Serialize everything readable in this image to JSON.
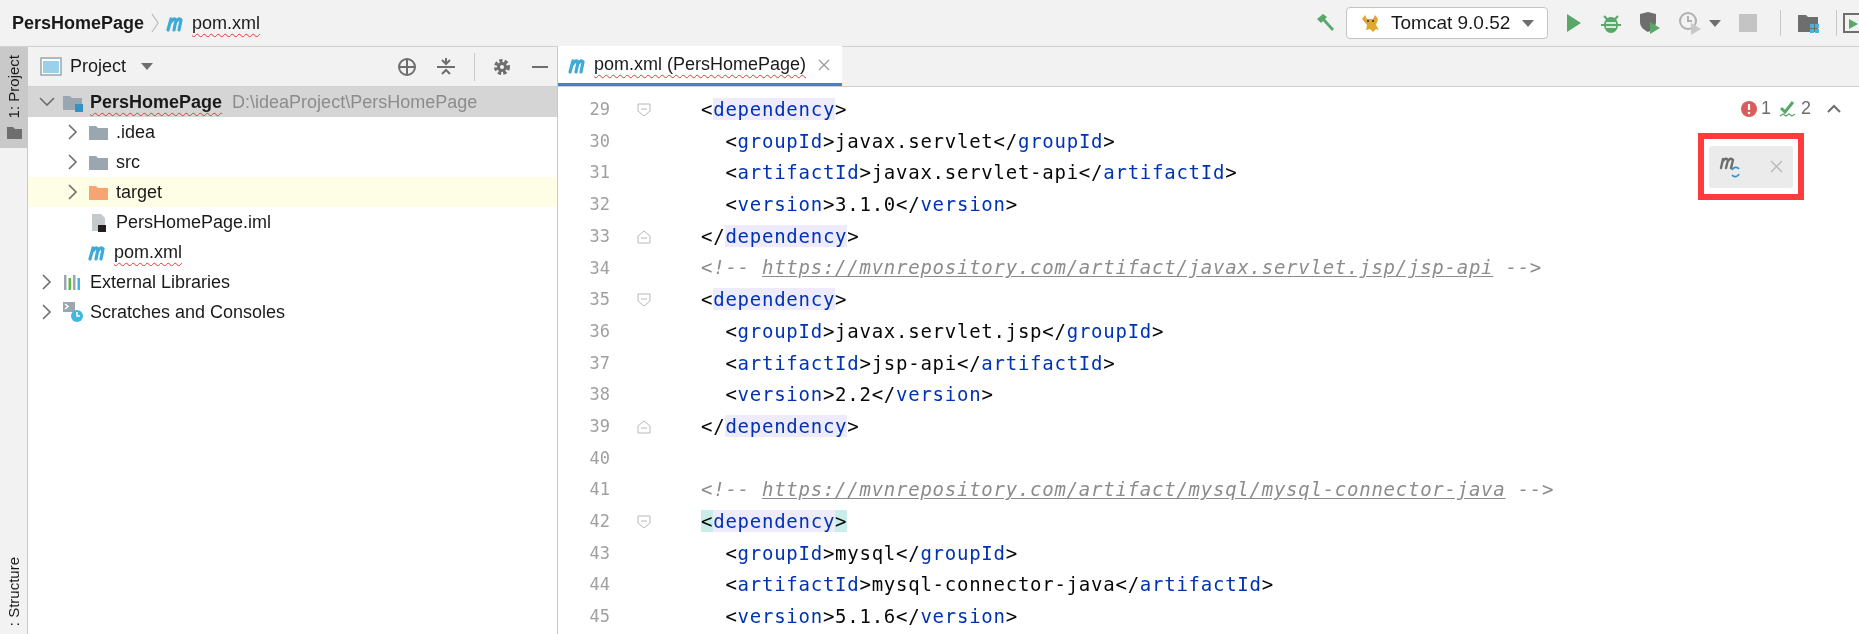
{
  "breadcrumb": [
    {
      "label": "PersHomePage",
      "kind": "project",
      "typo": false
    },
    {
      "label": "pom.xml",
      "kind": "maven_file",
      "typo": true
    }
  ],
  "toolbar": {
    "run_config": "Tomcat 9.0.52"
  },
  "tool_stripe": [
    {
      "label": "1: Project",
      "selected": true
    },
    {
      "label": ": Structure",
      "selected": false
    }
  ],
  "project_panel": {
    "title": "Project",
    "tree": [
      {
        "label": "PersHomePage",
        "path": "D:\\ideaProject\\PersHomePage",
        "kind": "module",
        "expanded": true,
        "selected": true,
        "highlighted": false,
        "typo": true,
        "children": [
          {
            "label": ".idea",
            "kind": "folder",
            "expanded": false,
            "selected": false,
            "highlighted": false,
            "typo": false
          },
          {
            "label": "src",
            "kind": "folder",
            "expanded": false,
            "selected": false,
            "highlighted": false,
            "typo": false
          },
          {
            "label": "target",
            "kind": "excluded_folder",
            "expanded": false,
            "selected": false,
            "highlighted": true,
            "typo": false
          },
          {
            "label": "PersHomePage.iml",
            "kind": "iml_file",
            "selected": false,
            "highlighted": false,
            "typo": false
          },
          {
            "label": "pom.xml",
            "kind": "maven_file",
            "selected": false,
            "highlighted": false,
            "typo": true
          }
        ]
      },
      {
        "label": "External Libraries",
        "kind": "libraries",
        "expanded": false,
        "selected": false,
        "highlighted": false,
        "typo": false
      },
      {
        "label": "Scratches and Consoles",
        "kind": "scratches",
        "expanded": false,
        "selected": false,
        "highlighted": false,
        "typo": false
      }
    ]
  },
  "editor": {
    "tabs": [
      {
        "label": "pom.xml (PersHomePage)",
        "selected": true,
        "typo": true
      }
    ],
    "inspections": [
      {
        "kind": "error",
        "count": "1"
      },
      {
        "kind": "weak_warning",
        "count": "2"
      }
    ],
    "lines": [
      {
        "number": "29",
        "kind": "fold_start",
        "segments": [
          {
            "kind": "text",
            "text": "<"
          },
          {
            "kind": "tag_hl",
            "text": "dependency"
          },
          {
            "kind": "text",
            "text": ">"
          }
        ]
      },
      {
        "number": "30",
        "segments": [
          {
            "kind": "text",
            "text": "  <"
          },
          {
            "kind": "tag",
            "text": "groupId"
          },
          {
            "kind": "text",
            "text": ">javax.servlet</"
          },
          {
            "kind": "tag",
            "text": "groupId"
          },
          {
            "kind": "text",
            "text": ">"
          }
        ]
      },
      {
        "number": "31",
        "segments": [
          {
            "kind": "text",
            "text": "  <"
          },
          {
            "kind": "tag",
            "text": "artifactId"
          },
          {
            "kind": "text",
            "text": ">javax.servlet-api</"
          },
          {
            "kind": "tag",
            "text": "artifactId"
          },
          {
            "kind": "text",
            "text": ">"
          }
        ]
      },
      {
        "number": "32",
        "segments": [
          {
            "kind": "text",
            "text": "  <"
          },
          {
            "kind": "tag",
            "text": "version"
          },
          {
            "kind": "text",
            "text": ">3.1.0</"
          },
          {
            "kind": "tag",
            "text": "version"
          },
          {
            "kind": "text",
            "text": ">"
          }
        ]
      },
      {
        "number": "33",
        "kind": "fold_end",
        "segments": [
          {
            "kind": "text",
            "text": "</"
          },
          {
            "kind": "tag_hl",
            "text": "dependency"
          },
          {
            "kind": "text",
            "text": ">"
          }
        ]
      },
      {
        "number": "34",
        "segments": [
          {
            "kind": "comment",
            "text": "<!-- "
          },
          {
            "kind": "link",
            "text": "https://mvnrepository.com/artifact/javax.servlet.jsp/jsp-api"
          },
          {
            "kind": "comment",
            "text": " -->"
          }
        ]
      },
      {
        "number": "35",
        "kind": "fold_start",
        "segments": [
          {
            "kind": "text",
            "text": "<"
          },
          {
            "kind": "tag_hl",
            "text": "dependency"
          },
          {
            "kind": "text",
            "text": ">"
          }
        ]
      },
      {
        "number": "36",
        "segments": [
          {
            "kind": "text",
            "text": "  <"
          },
          {
            "kind": "tag",
            "text": "groupId"
          },
          {
            "kind": "text",
            "text": ">javax.servlet.jsp</"
          },
          {
            "kind": "tag",
            "text": "groupId"
          },
          {
            "kind": "text",
            "text": ">"
          }
        ]
      },
      {
        "number": "37",
        "segments": [
          {
            "kind": "text",
            "text": "  <"
          },
          {
            "kind": "tag",
            "text": "artifactId"
          },
          {
            "kind": "text",
            "text": ">jsp-api</"
          },
          {
            "kind": "tag",
            "text": "artifactId"
          },
          {
            "kind": "text",
            "text": ">"
          }
        ]
      },
      {
        "number": "38",
        "segments": [
          {
            "kind": "text",
            "text": "  <"
          },
          {
            "kind": "tag",
            "text": "version"
          },
          {
            "kind": "text",
            "text": ">2.2</"
          },
          {
            "kind": "tag",
            "text": "version"
          },
          {
            "kind": "text",
            "text": ">"
          }
        ]
      },
      {
        "number": "39",
        "kind": "fold_end",
        "segments": [
          {
            "kind": "text",
            "text": "</"
          },
          {
            "kind": "tag_hl",
            "text": "dependency"
          },
          {
            "kind": "text",
            "text": ">"
          }
        ]
      },
      {
        "number": "40"
      },
      {
        "number": "41",
        "segments": [
          {
            "kind": "comment",
            "text": "<!-- "
          },
          {
            "kind": "link",
            "text": "https://mvnrepository.com/artifact/mysql/mysql-connector-java"
          },
          {
            "kind": "comment",
            "text": " -->"
          }
        ]
      },
      {
        "number": "42",
        "kind": "fold_start",
        "segments": [
          {
            "kind": "brace_match",
            "text": "<"
          },
          {
            "kind": "tag_hl",
            "text": "dependency"
          },
          {
            "kind": "brace_match",
            "text": ">"
          }
        ]
      },
      {
        "number": "43",
        "segments": [
          {
            "kind": "text",
            "text": "  <"
          },
          {
            "kind": "tag",
            "text": "groupId"
          },
          {
            "kind": "text",
            "text": ">mysql</"
          },
          {
            "kind": "tag",
            "text": "groupId"
          },
          {
            "kind": "text",
            "text": ">"
          }
        ]
      },
      {
        "number": "44",
        "segments": [
          {
            "kind": "text",
            "text": "  <"
          },
          {
            "kind": "tag",
            "text": "artifactId"
          },
          {
            "kind": "text",
            "text": ">mysql-connector-java</"
          },
          {
            "kind": "tag",
            "text": "artifactId"
          },
          {
            "kind": "text",
            "text": ">"
          }
        ]
      },
      {
        "number": "45",
        "segments": [
          {
            "kind": "text",
            "text": "  <"
          },
          {
            "kind": "tag",
            "text": "version"
          },
          {
            "kind": "text",
            "text": ">5.1.6</"
          },
          {
            "kind": "tag",
            "text": "version"
          },
          {
            "kind": "text",
            "text": ">"
          }
        ]
      }
    ]
  }
}
